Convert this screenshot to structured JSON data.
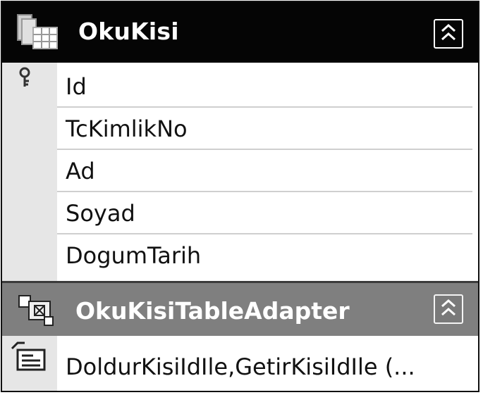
{
  "table": {
    "title": "OkuKisi",
    "icon": "table-icon",
    "collapse_icon": "double-chevron-up-icon",
    "columns": [
      {
        "name": "Id",
        "is_key": true
      },
      {
        "name": "TcKimlikNo",
        "is_key": false
      },
      {
        "name": "Ad",
        "is_key": false
      },
      {
        "name": "Soyad",
        "is_key": false
      },
      {
        "name": "DogumTarih",
        "is_key": false
      }
    ]
  },
  "adapter": {
    "title": "OkuKisiTableAdapter",
    "icon": "table-adapter-icon",
    "collapse_icon": "double-chevron-up-icon",
    "queries": [
      "DoldurKisiIdIle,GetirKisiIdIle (..."
    ]
  },
  "colors": {
    "table_header_bg": "#050505",
    "adapter_header_bg": "#7f7f7f",
    "gutter_bg": "#e6e6e6",
    "header_text": "#ffffff"
  }
}
